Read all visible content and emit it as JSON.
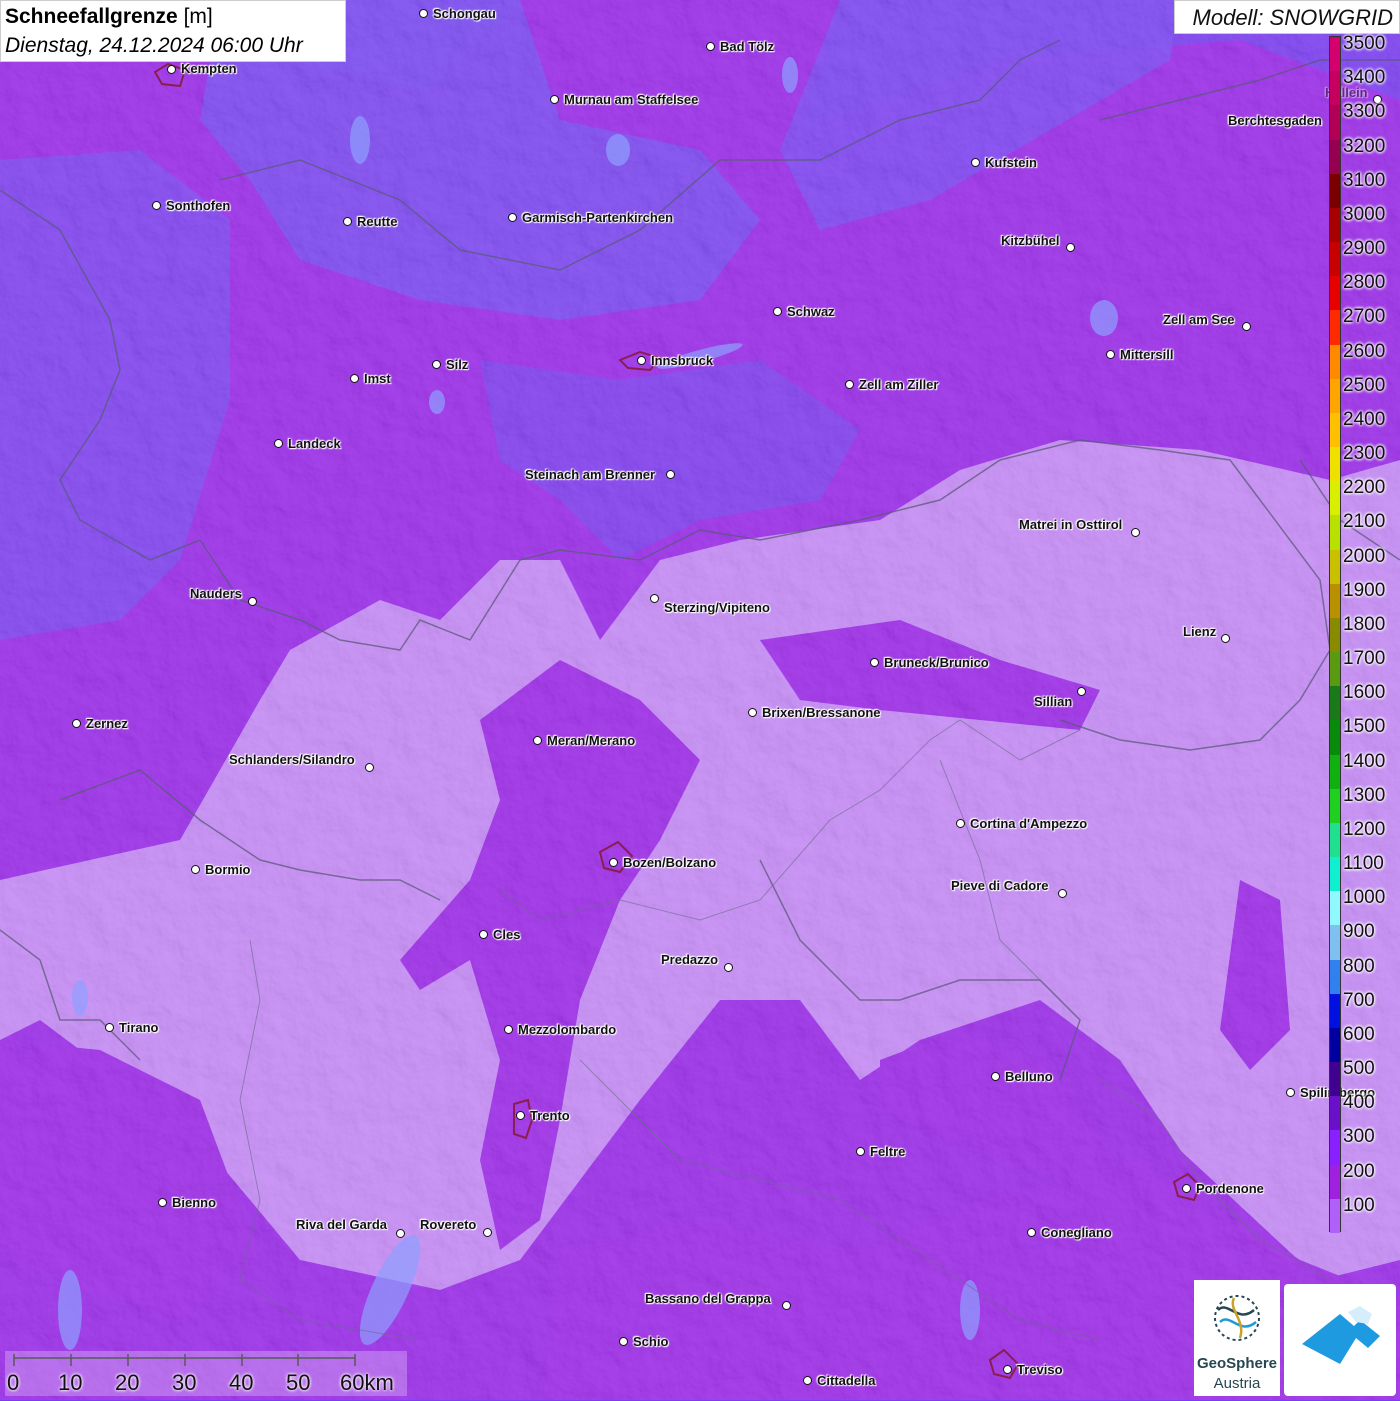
{
  "title": {
    "param": "Schneefallgrenze",
    "unit": "[m]",
    "datetime": "Dienstag, 24.12.2024 06:00 Uhr"
  },
  "model": "Modell: SNOWGRID",
  "legend": {
    "labels": [
      "3500",
      "3400",
      "3300",
      "3200",
      "3100",
      "3000",
      "2900",
      "2800",
      "2700",
      "2600",
      "2500",
      "2400",
      "2300",
      "2200",
      "2100",
      "2000",
      "1900",
      "1800",
      "1700",
      "1600",
      "1500",
      "1400",
      "1300",
      "1200",
      "1100",
      "1000",
      "900",
      "800",
      "700",
      "600",
      "500",
      "400",
      "300",
      "200",
      "100"
    ],
    "colors": [
      "#d4006e",
      "#c5005f",
      "#b20057",
      "#950050",
      "#7a0000",
      "#a80000",
      "#c80000",
      "#e60000",
      "#ff2a00",
      "#ff8a00",
      "#ffa500",
      "#ffc000",
      "#f0e000",
      "#d8f000",
      "#b8e000",
      "#c8c000",
      "#b89000",
      "#8a8a00",
      "#5a9a10",
      "#1a7a1a",
      "#0a8a0a",
      "#10b010",
      "#20d020",
      "#20e090",
      "#10f0d0",
      "#90f8ff",
      "#80c0f0",
      "#3080f0",
      "#0010e0",
      "#0000a0",
      "#400090",
      "#6a10c8",
      "#8a20ff",
      "#a020e0",
      "#b060f8"
    ]
  },
  "map_colors": {
    "violet_dark": "#7a3cf0",
    "violet_mid": "#9a28e6",
    "violet_light": "#c489f5",
    "magenta": "#a52fd8"
  },
  "cities": [
    "Schongau",
    "Bad Tölz",
    "Kempten",
    "Murnau am Staffelsee",
    "Kufstein",
    "Berchtesgaden",
    "Hallein",
    "Sonthofen",
    "Reutte",
    "Garmisch-Partenkirchen",
    "Kitzbühel",
    "Schwaz",
    "Zell am See",
    "Mittersill",
    "Innsbruck",
    "Imst",
    "Silz",
    "Zell am Ziller",
    "Landeck",
    "Steinach am Brenner",
    "Matrei in Osttirol",
    "Nauders",
    "Sterzing/Vipiteno",
    "Lienz",
    "Bruneck/Brunico",
    "Sillian",
    "Zernez",
    "Brixen/Bressanone",
    "Meran/Merano",
    "Schlanders/Silandro",
    "Cortina d'Ampezzo",
    "Bormio",
    "Bozen/Bolzano",
    "Pieve di Cadore",
    "Cles",
    "Predazzo",
    "Tirano",
    "Mezzolombardo",
    "Belluno",
    "Spilimbergo",
    "Trento",
    "Feltre",
    "Pordenone",
    "Bienno",
    "Riva del Garda",
    "Rovereto",
    "Conegliano",
    "Bassano del Grappa",
    "Schio",
    "Treviso",
    "Cittadella"
  ],
  "scale": {
    "ticks": [
      "0",
      "10",
      "20",
      "30",
      "40",
      "50",
      "60km"
    ]
  },
  "logos": {
    "geosphere_line1": "GeoSphere",
    "geosphere_line2": "Austria"
  }
}
